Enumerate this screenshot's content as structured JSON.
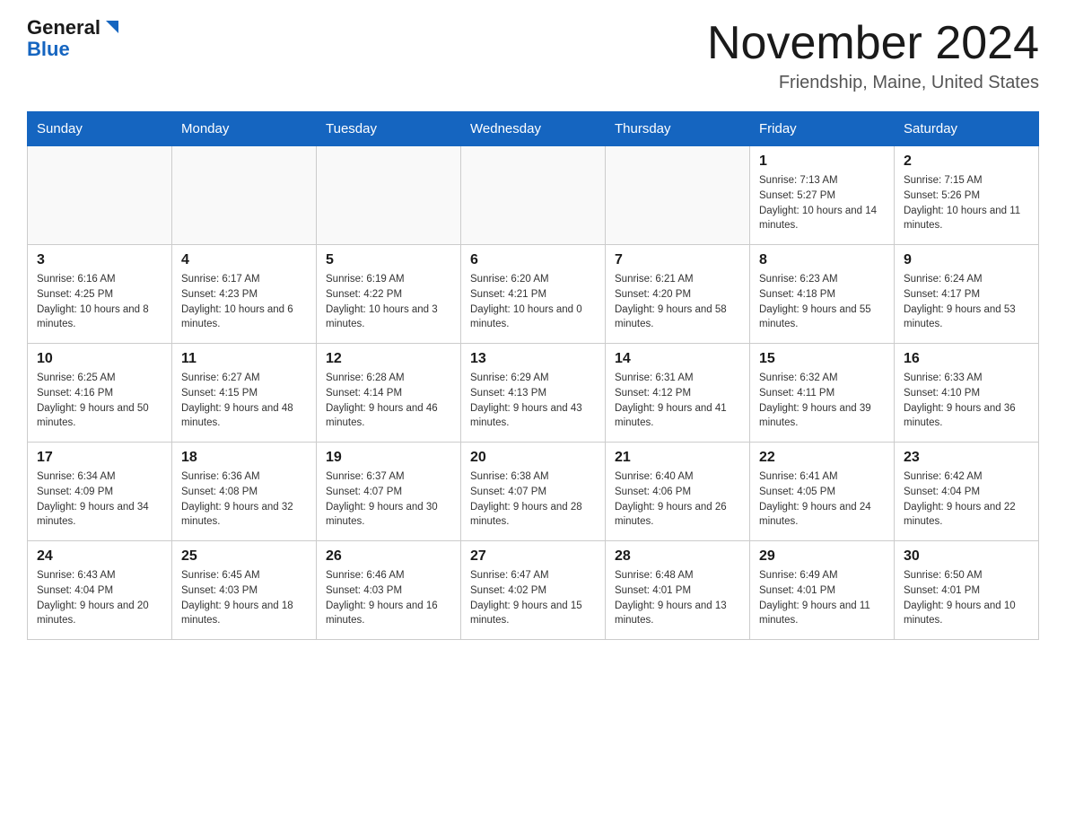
{
  "header": {
    "logo_general": "General",
    "logo_blue": "Blue",
    "month_title": "November 2024",
    "location": "Friendship, Maine, United States"
  },
  "days_of_week": [
    "Sunday",
    "Monday",
    "Tuesday",
    "Wednesday",
    "Thursday",
    "Friday",
    "Saturday"
  ],
  "weeks": [
    [
      {
        "day": "",
        "info": ""
      },
      {
        "day": "",
        "info": ""
      },
      {
        "day": "",
        "info": ""
      },
      {
        "day": "",
        "info": ""
      },
      {
        "day": "",
        "info": ""
      },
      {
        "day": "1",
        "info": "Sunrise: 7:13 AM\nSunset: 5:27 PM\nDaylight: 10 hours and 14 minutes."
      },
      {
        "day": "2",
        "info": "Sunrise: 7:15 AM\nSunset: 5:26 PM\nDaylight: 10 hours and 11 minutes."
      }
    ],
    [
      {
        "day": "3",
        "info": "Sunrise: 6:16 AM\nSunset: 4:25 PM\nDaylight: 10 hours and 8 minutes."
      },
      {
        "day": "4",
        "info": "Sunrise: 6:17 AM\nSunset: 4:23 PM\nDaylight: 10 hours and 6 minutes."
      },
      {
        "day": "5",
        "info": "Sunrise: 6:19 AM\nSunset: 4:22 PM\nDaylight: 10 hours and 3 minutes."
      },
      {
        "day": "6",
        "info": "Sunrise: 6:20 AM\nSunset: 4:21 PM\nDaylight: 10 hours and 0 minutes."
      },
      {
        "day": "7",
        "info": "Sunrise: 6:21 AM\nSunset: 4:20 PM\nDaylight: 9 hours and 58 minutes."
      },
      {
        "day": "8",
        "info": "Sunrise: 6:23 AM\nSunset: 4:18 PM\nDaylight: 9 hours and 55 minutes."
      },
      {
        "day": "9",
        "info": "Sunrise: 6:24 AM\nSunset: 4:17 PM\nDaylight: 9 hours and 53 minutes."
      }
    ],
    [
      {
        "day": "10",
        "info": "Sunrise: 6:25 AM\nSunset: 4:16 PM\nDaylight: 9 hours and 50 minutes."
      },
      {
        "day": "11",
        "info": "Sunrise: 6:27 AM\nSunset: 4:15 PM\nDaylight: 9 hours and 48 minutes."
      },
      {
        "day": "12",
        "info": "Sunrise: 6:28 AM\nSunset: 4:14 PM\nDaylight: 9 hours and 46 minutes."
      },
      {
        "day": "13",
        "info": "Sunrise: 6:29 AM\nSunset: 4:13 PM\nDaylight: 9 hours and 43 minutes."
      },
      {
        "day": "14",
        "info": "Sunrise: 6:31 AM\nSunset: 4:12 PM\nDaylight: 9 hours and 41 minutes."
      },
      {
        "day": "15",
        "info": "Sunrise: 6:32 AM\nSunset: 4:11 PM\nDaylight: 9 hours and 39 minutes."
      },
      {
        "day": "16",
        "info": "Sunrise: 6:33 AM\nSunset: 4:10 PM\nDaylight: 9 hours and 36 minutes."
      }
    ],
    [
      {
        "day": "17",
        "info": "Sunrise: 6:34 AM\nSunset: 4:09 PM\nDaylight: 9 hours and 34 minutes."
      },
      {
        "day": "18",
        "info": "Sunrise: 6:36 AM\nSunset: 4:08 PM\nDaylight: 9 hours and 32 minutes."
      },
      {
        "day": "19",
        "info": "Sunrise: 6:37 AM\nSunset: 4:07 PM\nDaylight: 9 hours and 30 minutes."
      },
      {
        "day": "20",
        "info": "Sunrise: 6:38 AM\nSunset: 4:07 PM\nDaylight: 9 hours and 28 minutes."
      },
      {
        "day": "21",
        "info": "Sunrise: 6:40 AM\nSunset: 4:06 PM\nDaylight: 9 hours and 26 minutes."
      },
      {
        "day": "22",
        "info": "Sunrise: 6:41 AM\nSunset: 4:05 PM\nDaylight: 9 hours and 24 minutes."
      },
      {
        "day": "23",
        "info": "Sunrise: 6:42 AM\nSunset: 4:04 PM\nDaylight: 9 hours and 22 minutes."
      }
    ],
    [
      {
        "day": "24",
        "info": "Sunrise: 6:43 AM\nSunset: 4:04 PM\nDaylight: 9 hours and 20 minutes."
      },
      {
        "day": "25",
        "info": "Sunrise: 6:45 AM\nSunset: 4:03 PM\nDaylight: 9 hours and 18 minutes."
      },
      {
        "day": "26",
        "info": "Sunrise: 6:46 AM\nSunset: 4:03 PM\nDaylight: 9 hours and 16 minutes."
      },
      {
        "day": "27",
        "info": "Sunrise: 6:47 AM\nSunset: 4:02 PM\nDaylight: 9 hours and 15 minutes."
      },
      {
        "day": "28",
        "info": "Sunrise: 6:48 AM\nSunset: 4:01 PM\nDaylight: 9 hours and 13 minutes."
      },
      {
        "day": "29",
        "info": "Sunrise: 6:49 AM\nSunset: 4:01 PM\nDaylight: 9 hours and 11 minutes."
      },
      {
        "day": "30",
        "info": "Sunrise: 6:50 AM\nSunset: 4:01 PM\nDaylight: 9 hours and 10 minutes."
      }
    ]
  ]
}
